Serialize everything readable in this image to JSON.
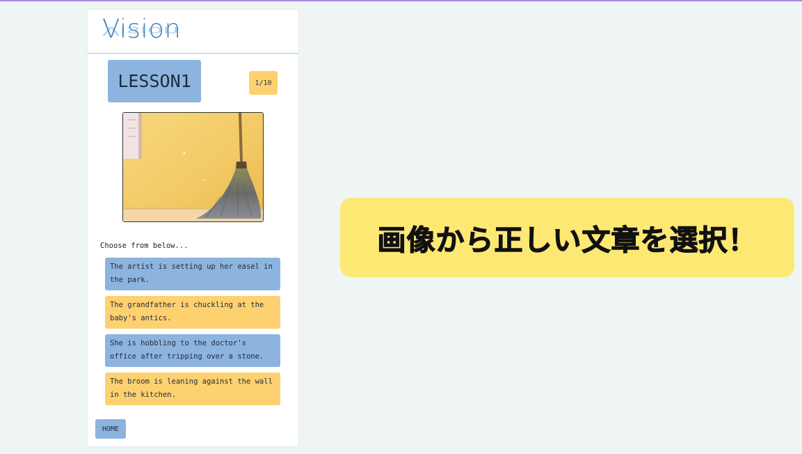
{
  "app": {
    "logo_text": "Vision"
  },
  "lesson": {
    "label": "LESSON1",
    "progress": "1/10"
  },
  "photo": {
    "subject": "broom leaning against yellow wall"
  },
  "quiz": {
    "prompt": "Choose from below...",
    "choices": [
      {
        "text": "The artist is setting up her easel in the park.",
        "color": "#8db4de"
      },
      {
        "text": "The grandfather is chuckling at the baby's antics.",
        "color": "#fdd170"
      },
      {
        "text": "She is hobbling to the doctor's office after tripping over a stone.",
        "color": "#8db4de"
      },
      {
        "text": "The broom is leaning against the wall in the kitchen.",
        "color": "#fdd170"
      }
    ]
  },
  "nav": {
    "home_label": "HOME"
  },
  "banner": {
    "text": "画像から正しい文章を選択！",
    "color": "#fde873"
  },
  "colors": {
    "background": "#eef5f4",
    "blue": "#8db4de",
    "orange": "#fdd170",
    "logo": "#3f86c4"
  }
}
